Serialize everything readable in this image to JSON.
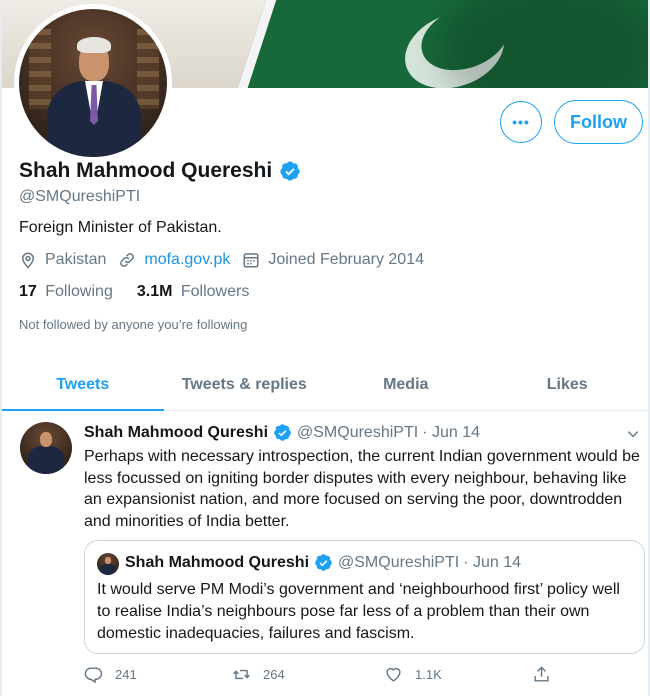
{
  "profile": {
    "name": "Shah Mahmood Quereshi",
    "handle": "@SMQureshiPTI",
    "bio": "Foreign Minister of Pakistan.",
    "location": "Pakistan",
    "website": "mofa.gov.pk",
    "joined": "Joined February 2014",
    "following_count": "17",
    "following_label": "Following",
    "followers_count": "3.1M",
    "followers_label": "Followers",
    "not_followed_note": "Not followed by anyone you’re following",
    "verified_icon": "verified-badge-icon",
    "accent_color": "#1da1f2"
  },
  "buttons": {
    "more": "•••",
    "follow": "Follow"
  },
  "tabs": [
    {
      "label": "Tweets",
      "active": true
    },
    {
      "label": "Tweets & replies",
      "active": false
    },
    {
      "label": "Media",
      "active": false
    },
    {
      "label": "Likes",
      "active": false
    }
  ],
  "tweet": {
    "author": "Shah Mahmood Qureshi",
    "handle": "@SMQureshiPTI",
    "date": "· Jun 14",
    "text": "Perhaps with necessary introspection, the current Indian government would be less focussed on igniting border disputes with every neighbour, behaving like an expansionist nation, and more focused on serving the poor, downtrodden and minorities of India better.",
    "quote": {
      "author": "Shah Mahmood Qureshi",
      "handle": "@SMQureshiPTI",
      "date": "· Jun 14",
      "text": "It would serve PM Modi’s government and ‘neighbourhood first’ policy well to realise India’s neighbours pose far less of a problem than their own domestic inadequacies, failures and fascism."
    },
    "replies": "241",
    "retweets": "264",
    "likes": "1.1K"
  }
}
